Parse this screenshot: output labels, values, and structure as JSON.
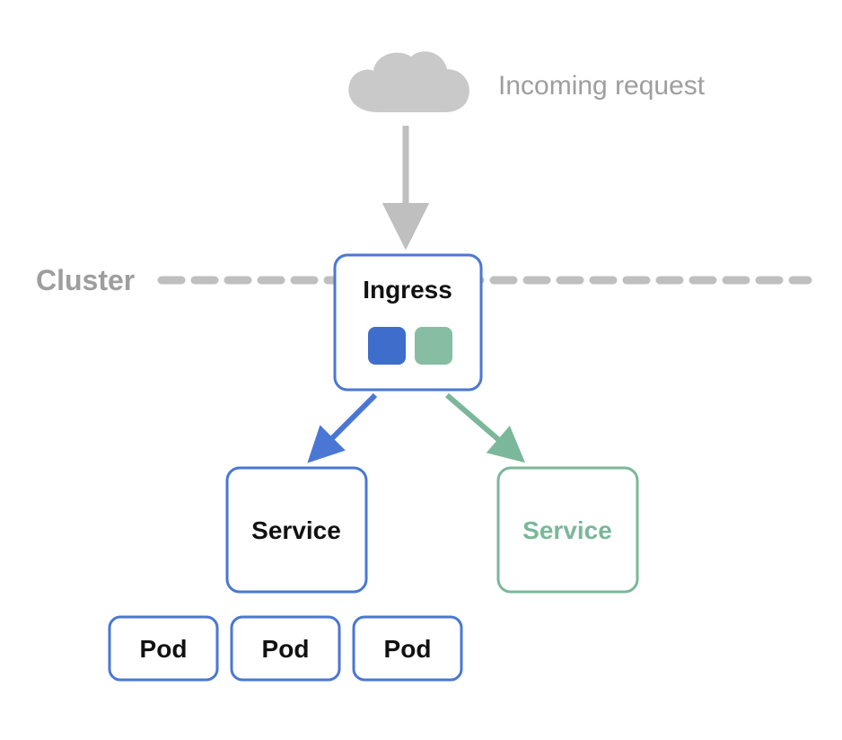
{
  "labels": {
    "incoming": "Incoming request",
    "cluster": "Cluster",
    "ingress": "Ingress",
    "service_blue": "Service",
    "service_green": "Service",
    "pod1": "Pod",
    "pod2": "Pod",
    "pod3": "Pod"
  },
  "colors": {
    "gray": "#BFBFBF",
    "gray_text": "#9E9E9E",
    "blue": "#4A77D4",
    "blue_fill": "#3E6DCB",
    "green": "#7BB79A",
    "green_fill": "#87BDA3",
    "black": "#111111"
  }
}
